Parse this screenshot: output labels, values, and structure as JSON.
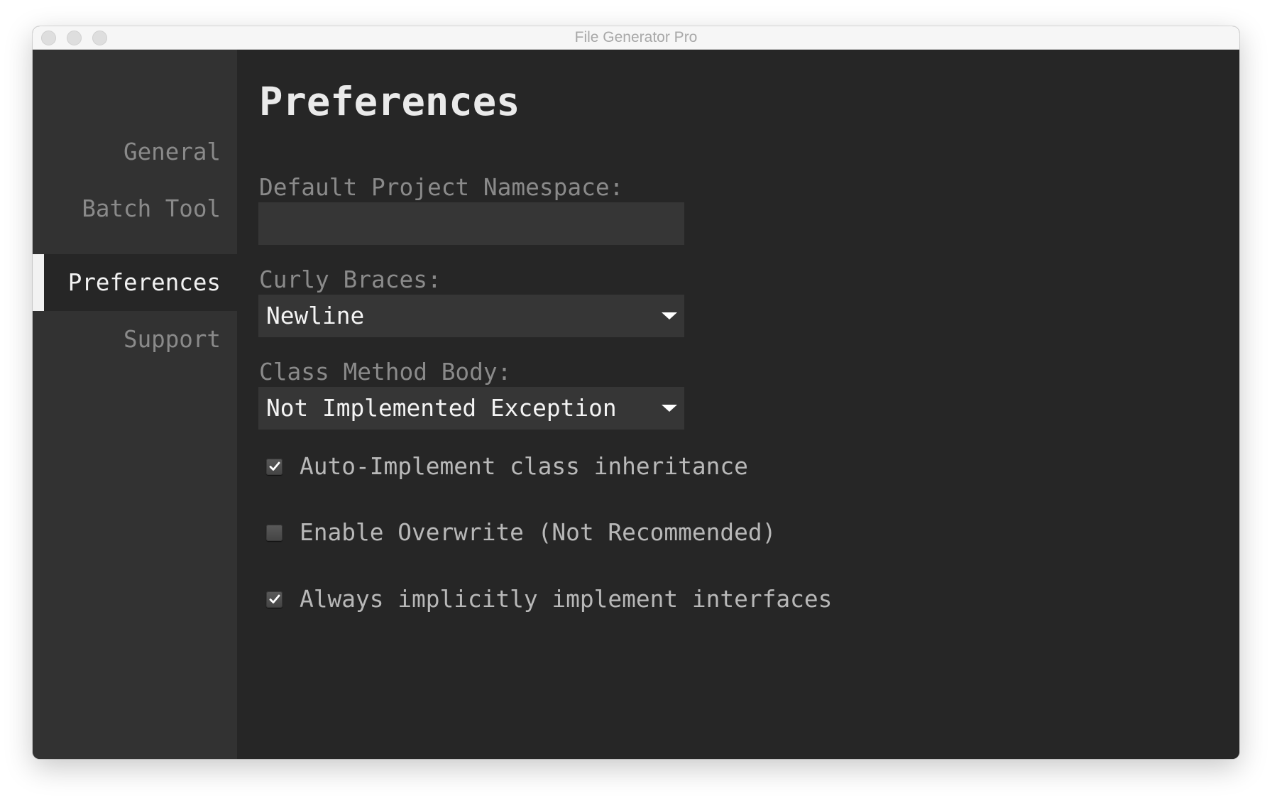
{
  "window": {
    "title": "File Generator Pro"
  },
  "sidebar": {
    "items": [
      {
        "label": "General",
        "active": false
      },
      {
        "label": "Batch Tool",
        "active": false
      },
      {
        "label": "Preferences",
        "active": true
      },
      {
        "label": "Support",
        "active": false
      }
    ]
  },
  "main": {
    "title": "Preferences",
    "namespace": {
      "label": "Default Project Namespace:",
      "value": "",
      "placeholder": ""
    },
    "curly_braces": {
      "label": "Curly Braces:",
      "selected": "Newline"
    },
    "class_method_body": {
      "label": "Class Method Body:",
      "selected": "Not Implemented Exception"
    },
    "options": [
      {
        "label": "Auto-Implement class inheritance",
        "checked": true
      },
      {
        "label": "Enable Overwrite (Not Recommended)",
        "checked": false
      },
      {
        "label": "Always implicitly implement interfaces",
        "checked": true
      }
    ]
  },
  "colors": {
    "sidebar_bg": "#323232",
    "content_bg": "#262626",
    "input_bg": "#363636",
    "active_indicator": "#f2f2f2",
    "titlebar_bg": "#f6f6f6"
  },
  "icons": {
    "dropdown": "chevron-down-icon",
    "check": "checkmark-icon"
  }
}
